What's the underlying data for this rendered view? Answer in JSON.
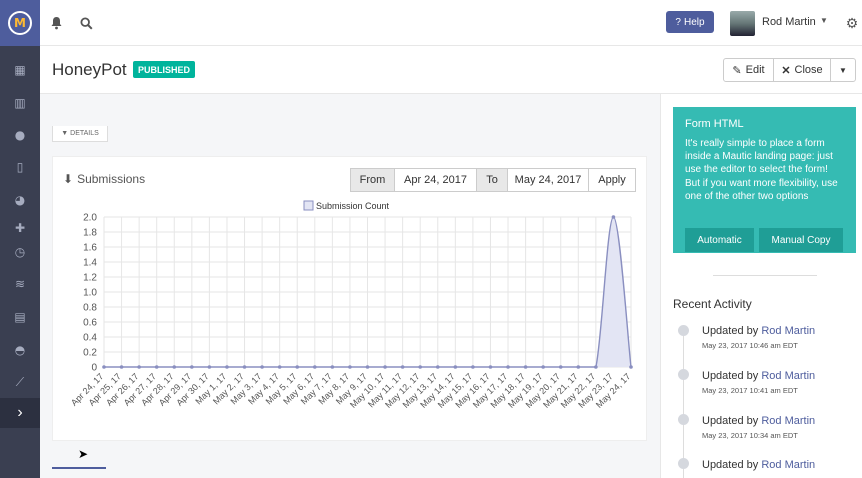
{
  "sidebar": {
    "logo_letter": "M",
    "items": [
      {
        "icon": "dashboard-icon",
        "glyph": "▦"
      },
      {
        "icon": "calendar-icon",
        "glyph": "▥"
      },
      {
        "icon": "contacts-icon",
        "glyph": "●"
      },
      {
        "icon": "components-icon",
        "glyph": "▯"
      },
      {
        "icon": "pie-icon",
        "glyph": "◕"
      },
      {
        "icon": "puzzle-icon",
        "glyph": "✚"
      },
      {
        "icon": "clock-icon",
        "glyph": "◷"
      },
      {
        "icon": "rss-icon",
        "glyph": "≋"
      },
      {
        "icon": "reports-icon",
        "glyph": "▤"
      },
      {
        "icon": "gauge-icon",
        "glyph": "◓"
      },
      {
        "icon": "chart-icon",
        "glyph": "⟋"
      }
    ],
    "expand_glyph": "›"
  },
  "topbar": {
    "help_label": "Help",
    "user_name": "Rod Martin"
  },
  "header": {
    "title": "HoneyPot",
    "status": "PUBLISHED",
    "edit_label": "Edit",
    "close_label": "Close"
  },
  "details_label": "DETAILS",
  "submissions": {
    "title": "Submissions",
    "from_label": "From",
    "from_value": "Apr 24, 2017",
    "to_label": "To",
    "to_value": "May 24, 2017",
    "apply_label": "Apply"
  },
  "chart_data": {
    "type": "line",
    "legend": "Submission Count",
    "categories": [
      "Apr 24, 17",
      "Apr 25, 17",
      "Apr 26, 17",
      "Apr 27, 17",
      "Apr 28, 17",
      "Apr 29, 17",
      "Apr 30, 17",
      "May 1, 17",
      "May 2, 17",
      "May 3, 17",
      "May 4, 17",
      "May 5, 17",
      "May 6, 17",
      "May 7, 17",
      "May 8, 17",
      "May 9, 17",
      "May 10, 17",
      "May 11, 17",
      "May 12, 17",
      "May 13, 17",
      "May 14, 17",
      "May 15, 17",
      "May 16, 17",
      "May 17, 17",
      "May 18, 17",
      "May 19, 17",
      "May 20, 17",
      "May 21, 17",
      "May 22, 17",
      "May 23, 17",
      "May 24, 17"
    ],
    "values": [
      0,
      0,
      0,
      0,
      0,
      0,
      0,
      0,
      0,
      0,
      0,
      0,
      0,
      0,
      0,
      0,
      0,
      0,
      0,
      0,
      0,
      0,
      0,
      0,
      0,
      0,
      0,
      0,
      0,
      2,
      0
    ],
    "yticks": [
      "2.0",
      "1.8",
      "1.6",
      "1.4",
      "1.2",
      "1.0",
      "0.8",
      "0.6",
      "0.4",
      "0.2",
      "0"
    ],
    "ylim": [
      0,
      2
    ],
    "grid": true,
    "legend_position": "top-center",
    "line_color": "#8a8fc0",
    "fill_color": "#e3e5f4"
  },
  "form_html": {
    "title": "Form HTML",
    "description": "It's really simple to place a form inside a Mautic landing page: just use the editor to select the form! But if you want more flexibility, use one of the other two options",
    "automatic_label": "Automatic",
    "manual_copy_label": "Manual Copy"
  },
  "recent_activity": {
    "title": "Recent Activity",
    "items": [
      {
        "action": "Updated by",
        "user": "Rod Martin",
        "date": "May 23, 2017 10:46 am EDT"
      },
      {
        "action": "Updated by",
        "user": "Rod Martin",
        "date": "May 23, 2017 10:41 am EDT"
      },
      {
        "action": "Updated by",
        "user": "Rod Martin",
        "date": "May 23, 2017 10:34 am EDT"
      },
      {
        "action": "Updated by",
        "user": "Rod Martin",
        "date": ""
      }
    ]
  }
}
